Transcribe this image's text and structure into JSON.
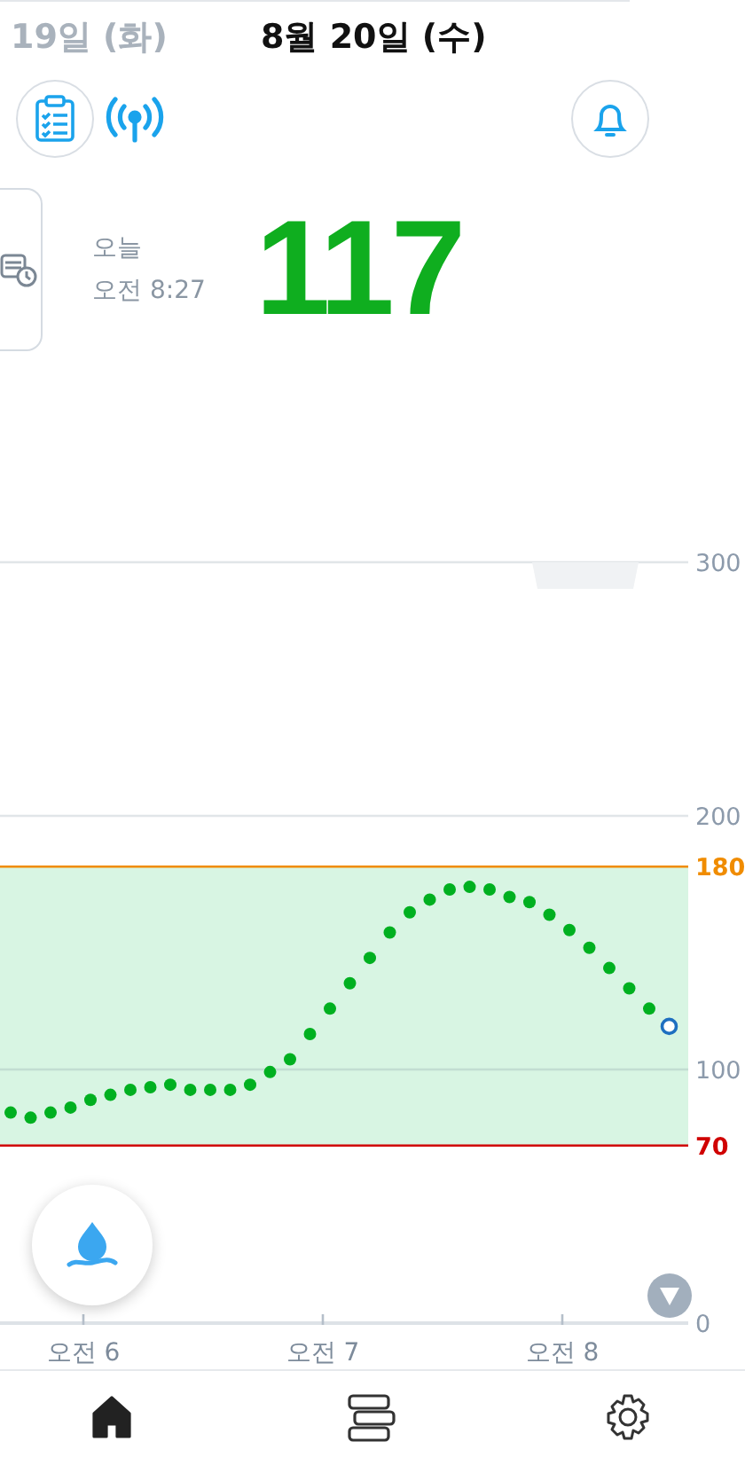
{
  "header": {
    "previous_day": "19일 (화)",
    "current_day": "8월 20일 (수)"
  },
  "reading": {
    "day": "오늘",
    "time": "오전 8:27",
    "value": "117"
  },
  "chart": {
    "chart_data": {
      "type": "scatter",
      "categories": [
        null,
        null,
        null,
        null,
        "오전 6",
        null,
        null,
        null,
        null,
        null,
        null,
        null,
        null,
        null,
        null,
        null,
        "오전 7",
        null,
        null,
        null,
        null,
        null,
        null,
        null,
        null,
        null,
        null,
        null,
        "오전 8",
        null,
        null,
        null,
        null,
        null
      ],
      "series": [
        {
          "color": "#00b020",
          "values": [
            83,
            81,
            83,
            85,
            88,
            90,
            92,
            93,
            94,
            92,
            92,
            92,
            94,
            99,
            104,
            114,
            124,
            134,
            144,
            154,
            162,
            167,
            171,
            172,
            171,
            168,
            166,
            161,
            155,
            148,
            140,
            132,
            124,
            null
          ]
        },
        {
          "color": "#1e6fc0",
          "values": [
            null,
            null,
            null,
            null,
            null,
            null,
            null,
            null,
            null,
            null,
            null,
            null,
            null,
            null,
            null,
            null,
            null,
            null,
            null,
            null,
            null,
            null,
            null,
            null,
            null,
            null,
            null,
            null,
            null,
            null,
            null,
            null,
            null,
            117
          ]
        }
      ],
      "ylim": [
        0,
        300
      ],
      "yticks": [
        0,
        70,
        100,
        180,
        200,
        300
      ],
      "bands": [
        {
          "axis": "y",
          "from": 70,
          "to": 180,
          "color": "#d8f5e3"
        }
      ],
      "ref_lines": [
        {
          "axis": "y",
          "value": 180,
          "color": "#f08c00"
        },
        {
          "axis": "y",
          "value": 70,
          "color": "#d00000"
        }
      ]
    }
  },
  "nav": [
    {
      "kind": "home",
      "selected": true
    },
    {
      "kind": "list",
      "selected": false
    },
    {
      "kind": "settings",
      "selected": false
    }
  ]
}
